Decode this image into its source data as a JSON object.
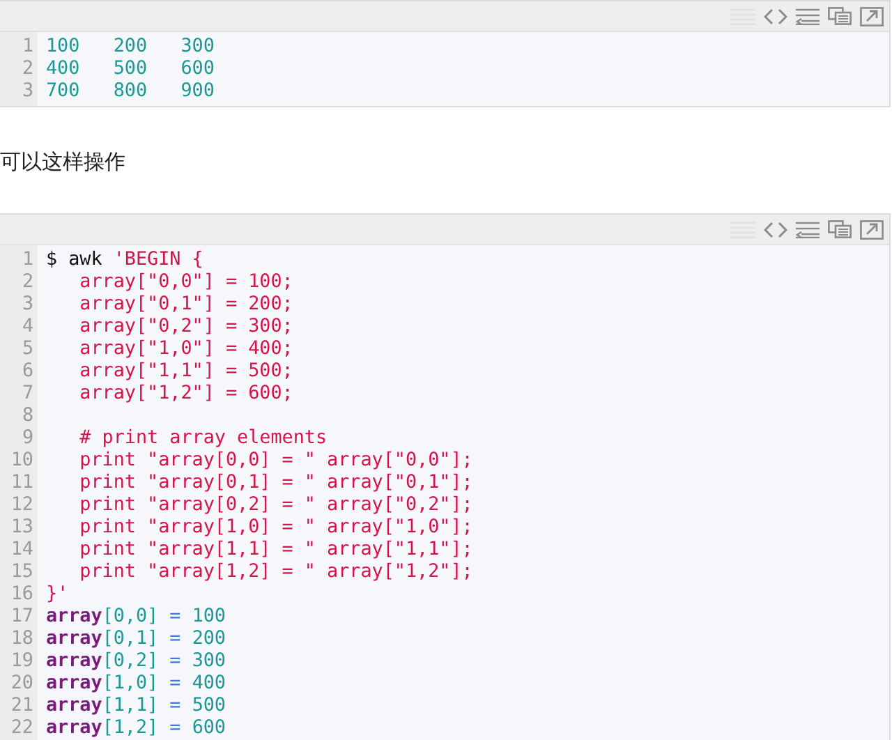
{
  "blocks": [
    {
      "kind": "code",
      "lines": [
        {
          "number": "1",
          "tokens": [
            {
              "kind": "number",
              "text": "100   200   300"
            }
          ]
        },
        {
          "number": "2",
          "tokens": [
            {
              "kind": "number",
              "text": "400   500   600"
            }
          ]
        },
        {
          "number": "3",
          "tokens": [
            {
              "kind": "number",
              "text": "700   800   900"
            }
          ]
        }
      ]
    },
    {
      "kind": "text",
      "text": "可以这样操作"
    },
    {
      "kind": "code",
      "lines": [
        {
          "number": "1",
          "tokens": [
            {
              "kind": "plain",
              "text": "$ awk "
            },
            {
              "kind": "string",
              "text": "'BEGIN {"
            }
          ]
        },
        {
          "number": "2",
          "tokens": [
            {
              "kind": "string",
              "text": "   array[\"0,0\"] = 100;"
            }
          ]
        },
        {
          "number": "3",
          "tokens": [
            {
              "kind": "string",
              "text": "   array[\"0,1\"] = 200;"
            }
          ]
        },
        {
          "number": "4",
          "tokens": [
            {
              "kind": "string",
              "text": "   array[\"0,2\"] = 300;"
            }
          ]
        },
        {
          "number": "5",
          "tokens": [
            {
              "kind": "string",
              "text": "   array[\"1,0\"] = 400;"
            }
          ]
        },
        {
          "number": "6",
          "tokens": [
            {
              "kind": "string",
              "text": "   array[\"1,1\"] = 500;"
            }
          ]
        },
        {
          "number": "7",
          "tokens": [
            {
              "kind": "string",
              "text": "   array[\"1,2\"] = 600;"
            }
          ]
        },
        {
          "number": "8"
        },
        {
          "number": "9",
          "tokens": [
            {
              "kind": "string",
              "text": "   # print array elements"
            }
          ]
        },
        {
          "number": "10",
          "tokens": [
            {
              "kind": "string",
              "text": "   print \"array[0,0] = \" array[\"0,0\"];"
            }
          ]
        },
        {
          "number": "11",
          "tokens": [
            {
              "kind": "string",
              "text": "   print \"array[0,1] = \" array[\"0,1\"];"
            }
          ]
        },
        {
          "number": "12",
          "tokens": [
            {
              "kind": "string",
              "text": "   print \"array[0,2] = \" array[\"0,2\"];"
            }
          ]
        },
        {
          "number": "13",
          "tokens": [
            {
              "kind": "string",
              "text": "   print \"array[1,0] = \" array[\"1,0\"];"
            }
          ]
        },
        {
          "number": "14",
          "tokens": [
            {
              "kind": "string",
              "text": "   print \"array[1,1] = \" array[\"1,1\"];"
            }
          ]
        },
        {
          "number": "15",
          "tokens": [
            {
              "kind": "string",
              "text": "   print \"array[1,2] = \" array[\"1,2\"];"
            }
          ]
        },
        {
          "number": "16",
          "tokens": [
            {
              "kind": "string",
              "text": "}'"
            }
          ]
        },
        {
          "number": "17",
          "tokens": [
            {
              "kind": "keyword",
              "text": "array"
            },
            {
              "kind": "number",
              "text": "[0,0]"
            },
            {
              "kind": "operator",
              "text": " = "
            },
            {
              "kind": "number",
              "text": "100"
            }
          ]
        },
        {
          "number": "18",
          "tokens": [
            {
              "kind": "keyword",
              "text": "array"
            },
            {
              "kind": "number",
              "text": "[0,1]"
            },
            {
              "kind": "operator",
              "text": " = "
            },
            {
              "kind": "number",
              "text": "200"
            }
          ]
        },
        {
          "number": "19",
          "tokens": [
            {
              "kind": "keyword",
              "text": "array"
            },
            {
              "kind": "number",
              "text": "[0,2]"
            },
            {
              "kind": "operator",
              "text": " = "
            },
            {
              "kind": "number",
              "text": "300"
            }
          ]
        },
        {
          "number": "20",
          "tokens": [
            {
              "kind": "keyword",
              "text": "array"
            },
            {
              "kind": "number",
              "text": "[1,0]"
            },
            {
              "kind": "operator",
              "text": " = "
            },
            {
              "kind": "number",
              "text": "400"
            }
          ]
        },
        {
          "number": "21",
          "tokens": [
            {
              "kind": "keyword",
              "text": "array"
            },
            {
              "kind": "number",
              "text": "[1,1]"
            },
            {
              "kind": "operator",
              "text": " = "
            },
            {
              "kind": "number",
              "text": "500"
            }
          ]
        },
        {
          "number": "22",
          "tokens": [
            {
              "kind": "keyword",
              "text": "array"
            },
            {
              "kind": "number",
              "text": "[1,2]"
            },
            {
              "kind": "operator",
              "text": " = "
            },
            {
              "kind": "number",
              "text": "600"
            }
          ]
        }
      ]
    }
  ]
}
